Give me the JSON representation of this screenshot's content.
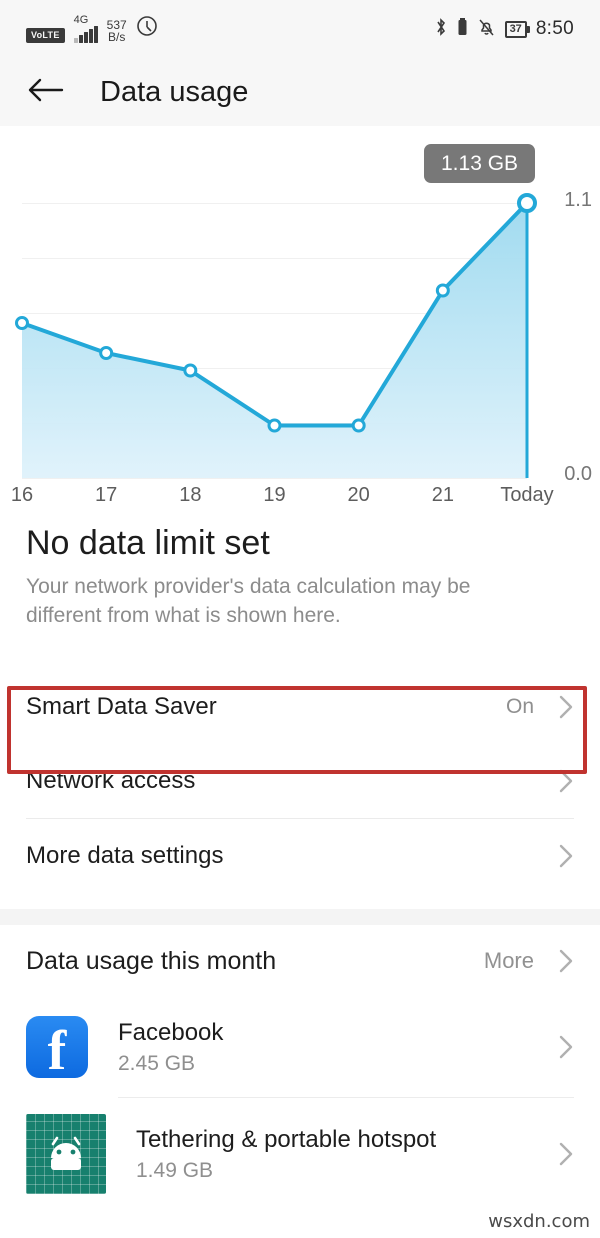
{
  "status_bar": {
    "volte_label": "VoLTE",
    "network_generation": "4G",
    "net_speed_value": "537",
    "net_speed_unit": "B/s",
    "battery_percent": "37",
    "time": "8:50",
    "icons": [
      "volte-badge",
      "signal-bars-icon",
      "data-speed-indicator",
      "do-not-disturb-icon",
      "bluetooth-icon",
      "battery-small-icon",
      "bell-muted-icon",
      "battery-icon"
    ]
  },
  "header": {
    "back_icon": "arrow-left-icon",
    "title": "Data usage"
  },
  "chart_data": {
    "type": "area",
    "title": "",
    "xlabel": "",
    "ylabel": "",
    "categories": [
      "16",
      "17",
      "18",
      "19",
      "20",
      "21",
      "Today"
    ],
    "values": [
      0.62,
      0.5,
      0.43,
      0.21,
      0.21,
      0.75,
      1.13
    ],
    "ylim": [
      0.0,
      1.1
    ],
    "ytick_labels": [
      "0.0",
      "1.1"
    ],
    "grid": true,
    "legend": "none",
    "annotations": [
      {
        "label": "1.13 GB",
        "at_category": "Today",
        "style": "tooltip"
      }
    ],
    "accent_color": "#23a8d8",
    "fill_color": "#a9ddf0",
    "tooltip_bg": "#787878"
  },
  "limit_section": {
    "headline": "No data limit set",
    "subtext": "Your network provider's data calculation may be different from what is shown here."
  },
  "settings_rows": [
    {
      "label": "Smart Data Saver",
      "value": "On",
      "chevron": "chevron-right-icon",
      "highlighted": true
    },
    {
      "label": "Network access",
      "value": "",
      "chevron": "chevron-right-icon",
      "highlighted": false
    },
    {
      "label": "More data settings",
      "value": "",
      "chevron": "chevron-right-icon",
      "highlighted": false
    }
  ],
  "month_section": {
    "title": "Data usage this month",
    "more_label": "More",
    "more_chevron": "chevron-right-icon",
    "apps": [
      {
        "name": "Facebook",
        "size": "2.45 GB",
        "icon": "facebook-icon"
      },
      {
        "name": "Tethering & portable hotspot",
        "size": "1.49 GB",
        "icon": "android-icon"
      }
    ]
  },
  "watermark": "wsxdn.com",
  "colors": {
    "accent": "#23a8d8",
    "highlight_border": "#c0332f",
    "facebook_blue": "#1877f2",
    "android_teal": "#17806e"
  }
}
